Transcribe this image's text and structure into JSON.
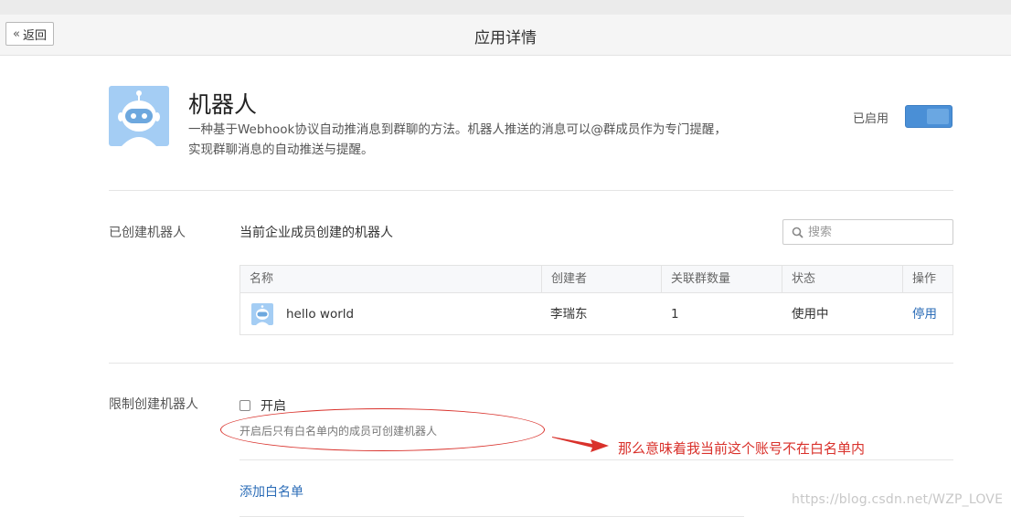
{
  "header": {
    "back_label": "返回",
    "title": "应用详情"
  },
  "app": {
    "name": "机器人",
    "desc_line1": "一种基于Webhook协议自动推消息到群聊的方法。机器人推送的消息可以@群成员作为专门提醒，",
    "desc_line2": "实现群聊消息的自动推送与提醒。",
    "status_label": "已启用",
    "enabled": true
  },
  "created_section": {
    "label": "已创建机器人",
    "title": "当前企业成员创建的机器人",
    "search": {
      "placeholder": "搜索",
      "value": ""
    },
    "table": {
      "columns": [
        "名称",
        "创建者",
        "关联群数量",
        "状态",
        "操作"
      ],
      "rows": [
        {
          "name": "hello world",
          "creator": "李瑞东",
          "group_count": "1",
          "status": "使用中",
          "action": "停用",
          "icon": "robot-avatar-icon"
        }
      ]
    }
  },
  "restrict_section": {
    "label": "限制创建机器人",
    "checkbox_label": "开启",
    "checked": false,
    "hint": "开启后只有白名单内的成员可创建机器人",
    "add_link": "添加白名单"
  },
  "annotation": {
    "text": "那么意味着我当前这个账号不在白名单内",
    "color": "#d9312b"
  },
  "watermark": "https://blog.csdn.net/WZP_LOVE",
  "colors": {
    "accent": "#4a8fd6",
    "link": "#2b6cb7",
    "robot_bg": "#a4cdf4"
  }
}
